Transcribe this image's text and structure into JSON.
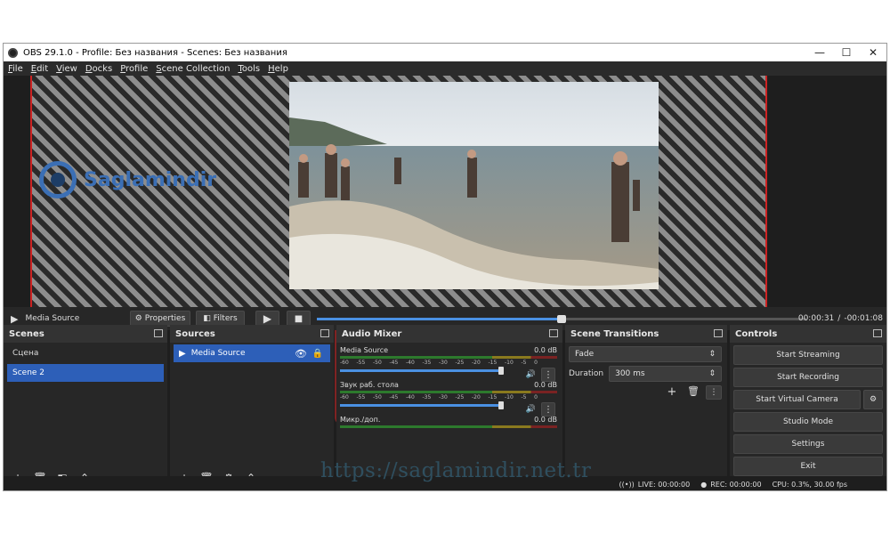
{
  "window": {
    "title": "OBS 29.1.0 - Profile: Без названия - Scenes: Без названия",
    "minimize": "—",
    "maximize": "☐",
    "close": "✕"
  },
  "menu": [
    "File",
    "Edit",
    "View",
    "Docks",
    "Profile",
    "Scene Collection",
    "Tools",
    "Help"
  ],
  "source_bar": {
    "source_name": "Media Source",
    "properties": "Properties",
    "filters": "Filters",
    "time_current": "00:00:31",
    "time_separator": "/",
    "time_remaining": "-00:01:08",
    "progress": 0.5
  },
  "scenes": {
    "title": "Scenes",
    "items": [
      "Сцена",
      "Scene 2"
    ],
    "selected": 1
  },
  "sources": {
    "title": "Sources",
    "items": [
      "Media Source"
    ]
  },
  "audio_mixer": {
    "title": "Audio Mixer",
    "ticks": [
      "-60",
      "-55",
      "-50",
      "-45",
      "-40",
      "-35",
      "-30",
      "-25",
      "-20",
      "-15",
      "-10",
      "-5",
      "0"
    ],
    "channels": [
      {
        "name": "Media Source",
        "db": "0.0 dB"
      },
      {
        "name": "Звук раб. стола",
        "db": "0.0 dB"
      },
      {
        "name": "Микр./доп.",
        "db": "0.0 dB"
      }
    ]
  },
  "transitions": {
    "title": "Scene Transitions",
    "selected": "Fade",
    "duration_label": "Duration",
    "duration_value": "300 ms"
  },
  "controls": {
    "title": "Controls",
    "buttons": [
      "Start Streaming",
      "Start Recording",
      "Start Virtual Camera",
      "Studio Mode",
      "Settings",
      "Exit"
    ]
  },
  "status": {
    "live": "LIVE: 00:00:00",
    "rec": "REC: 00:00:00",
    "cpu": "CPU: 0.3%, 30.00 fps"
  },
  "watermark": {
    "logo_text": "Saglamindir",
    "url": "https://saglamindir.net.tr"
  },
  "colors": {
    "accent": "#2d5fb8",
    "preview_border": "#cc2222",
    "volume": "#4a90e2"
  }
}
